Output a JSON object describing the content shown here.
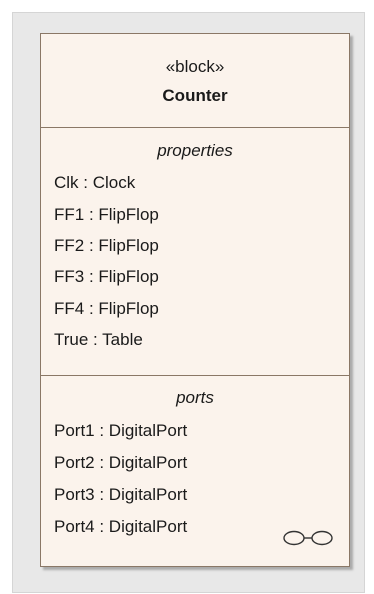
{
  "block": {
    "stereotype": "«block»",
    "name": "Counter",
    "properties": {
      "title": "properties",
      "items": [
        "Clk : Clock",
        "FF1 : FlipFlop",
        "FF2 : FlipFlop",
        "FF3 : FlipFlop",
        "FF4 : FlipFlop",
        "True : Table"
      ]
    },
    "ports": {
      "title": "ports",
      "items": [
        "Port1 : DigitalPort",
        "Port2 : DigitalPort",
        "Port3 : DigitalPort",
        "Port4 : DigitalPort"
      ]
    }
  },
  "colors": {
    "block_fill": "#fbf3ec",
    "block_border": "#8a7766",
    "backdrop": "#e8e8e8"
  },
  "icons": {
    "compartment_link": "linked-elements-icon"
  }
}
